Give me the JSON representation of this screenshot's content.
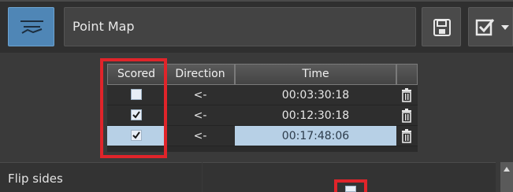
{
  "toolbar": {
    "title": "Point Map",
    "icons": {
      "map": "point-map-icon",
      "save": "save-icon",
      "check": "checkbox-checked-icon",
      "dropdown": "dropdown-arrow-icon"
    }
  },
  "table": {
    "headers": [
      "Scored",
      "Direction",
      "Time"
    ],
    "rows": [
      {
        "scored": false,
        "direction": "<-",
        "time": "00:03:30:18",
        "selected": false
      },
      {
        "scored": true,
        "direction": "<-",
        "time": "00:12:30:18",
        "selected": false
      },
      {
        "scored": true,
        "direction": "<-",
        "time": "00:17:48:06",
        "selected": true
      }
    ]
  },
  "properties": {
    "flip_sides_label": "Flip sides",
    "flip_sides_value": false
  },
  "colors": {
    "highlight": "#e0242a",
    "selected_row": "#b7d0e6",
    "accent_button": "#4f86b6"
  }
}
